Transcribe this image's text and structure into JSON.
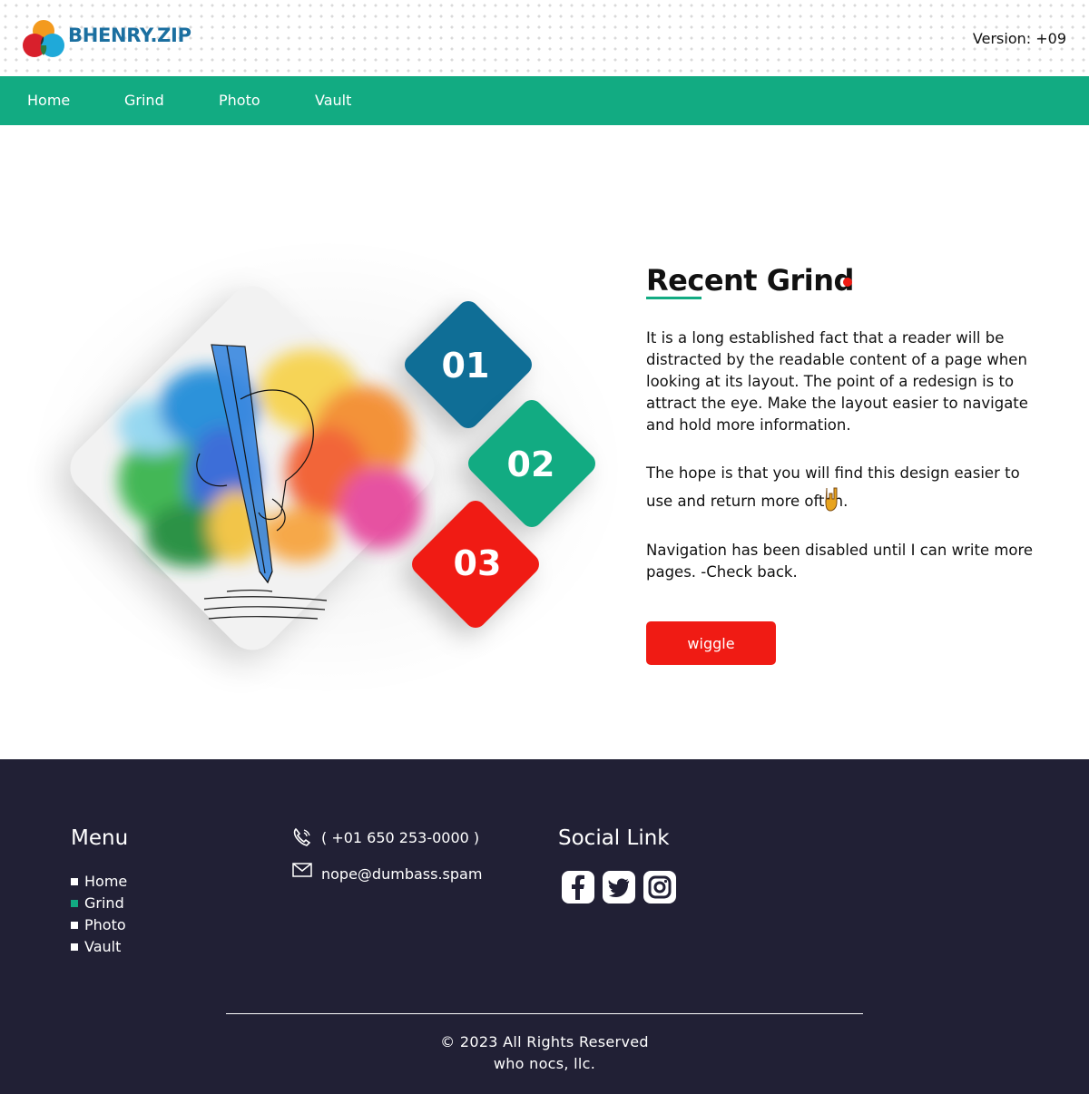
{
  "header": {
    "brand": "BHENRY.ZIP",
    "version": "Version: +09"
  },
  "nav": {
    "items": [
      {
        "label": "Home"
      },
      {
        "label": "Grind"
      },
      {
        "label": "Photo"
      },
      {
        "label": "Vault"
      }
    ],
    "color": "#12ab82"
  },
  "hero": {
    "numbers": [
      "01",
      "02",
      "03"
    ],
    "number_colors": [
      "#0f6e96",
      "#12ab82",
      "#f01b14"
    ],
    "title": "Recent Grind",
    "paragraphs": [
      "It is a long established fact that a reader will be distracted by the readable content of a page when looking at its layout. The point of a redesign is to attract the eye. Make the layout easier to navigate and hold more information.",
      "The hope is that you will find this design easier to use and return more often.",
      "Navigation has been disabled until I can write more pages. -Check back."
    ],
    "button_label": "wiggle",
    "accent": "#f01b14"
  },
  "footer": {
    "menu_heading": "Menu",
    "menu_items": [
      "Home",
      "Grind",
      "Photo",
      "Vault"
    ],
    "active_item": "Grind",
    "phone": "( +01 650 253-0000 )",
    "email": "nope@dumbass.spam",
    "social_heading": "Social Link",
    "social_icons": [
      "facebook-icon",
      "twitter-icon",
      "instagram-icon"
    ],
    "copyright": "© 2023 All Rights Reserved",
    "company": "who nocs, llc.",
    "background": "#212035"
  }
}
